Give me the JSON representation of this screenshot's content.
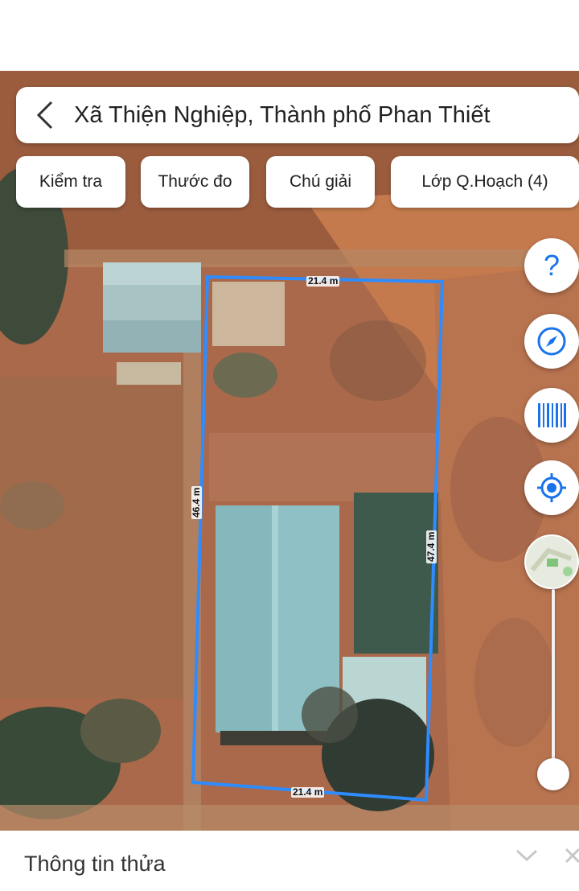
{
  "header": {
    "back_icon": "chevron-left-icon",
    "location_title": "Xã Thiện Nghiệp, Thành phố Phan Thiết"
  },
  "chips": [
    {
      "label": "Kiểm tra"
    },
    {
      "label": "Thước đo"
    },
    {
      "label": "Chú giải"
    },
    {
      "label": "Lớp Q.Hoạch (4)"
    }
  ],
  "map": {
    "view": "satellite",
    "parcel_outline_color": "#2f8cff",
    "measurements": {
      "top": "21.4 m",
      "left": "46.4 m",
      "right": "47.4 m",
      "bottom": "21.4 m"
    }
  },
  "controls": {
    "help_icon": "question-mark-icon",
    "compass_icon": "compass-icon",
    "barcode_icon": "barcode-icon",
    "locate_icon": "locate-icon",
    "layer_icon": "map-thumbnail-icon",
    "accent_color": "#1a73e8"
  },
  "bottom_panel": {
    "title": "Thông tin thửa",
    "expand_icon": "chevron-down-icon",
    "close_icon": "close-icon"
  }
}
